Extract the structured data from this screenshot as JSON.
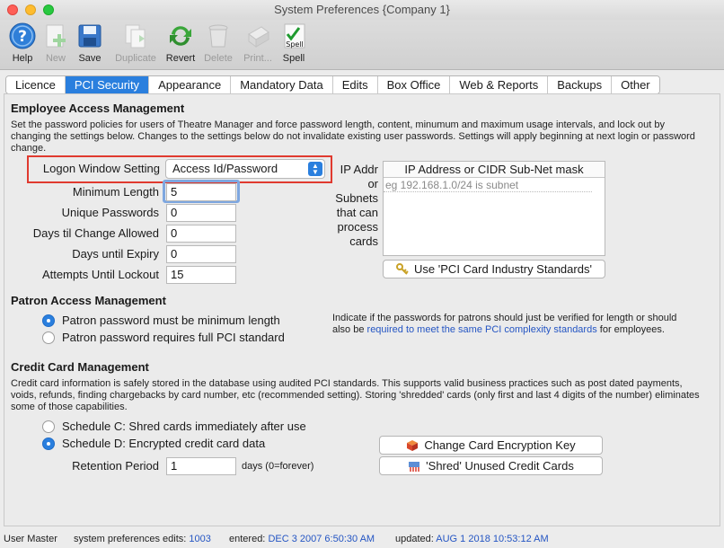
{
  "window": {
    "title": "System Preferences {Company 1}"
  },
  "toolbar": {
    "items": [
      {
        "label": "Help",
        "icon": "help-icon",
        "enabled": true
      },
      {
        "label": "New",
        "icon": "new-icon",
        "enabled": false
      },
      {
        "label": "Save",
        "icon": "save-icon",
        "enabled": true
      },
      {
        "label": "Duplicate",
        "icon": "duplicate-icon",
        "enabled": false
      },
      {
        "label": "Revert",
        "icon": "revert-icon",
        "enabled": true
      },
      {
        "label": "Delete",
        "icon": "delete-icon",
        "enabled": false
      },
      {
        "label": "Print...",
        "icon": "print-icon",
        "enabled": false
      },
      {
        "label": "Spell",
        "icon": "spell-icon",
        "enabled": true,
        "badge": "Spell"
      }
    ]
  },
  "tabs": [
    "Licence",
    "PCI Security",
    "Appearance",
    "Mandatory Data",
    "Edits",
    "Box Office",
    "Web & Reports",
    "Backups",
    "Other"
  ],
  "active_tab": "PCI Security",
  "employee": {
    "title": "Employee Access Management",
    "description": "Set the password policies for users of  Theatre Manager and force password length, content, minumum and maximum usage intervals, and lock out by changing the settings below.  Changes to the settings below do not invalidate existing user passwords.  Settings will apply beginning at next login or password change.",
    "logon_label": "Logon Window Setting",
    "logon_value": "Access Id/Password",
    "fields": [
      {
        "label": "Minimum Length",
        "value": "5"
      },
      {
        "label": "Unique Passwords",
        "value": "0"
      },
      {
        "label": "Days til Change Allowed",
        "value": "0"
      },
      {
        "label": "Days until Expiry",
        "value": "0"
      },
      {
        "label": "Attempts Until Lockout",
        "value": "15"
      }
    ],
    "ip_label": "IP Addr or Subnets that can process cards",
    "ip_label_lines": [
      "IP Addr",
      "or",
      "Subnets",
      "that can",
      "process",
      "cards"
    ],
    "ip_column_header": "IP Address or CIDR Sub-Net mask",
    "ip_placeholder": "eg 192.168.1.0/24 is subnet",
    "pci_button": "Use 'PCI Card Industry Standards'"
  },
  "patron": {
    "title": "Patron Access Management",
    "options": [
      {
        "label": "Patron password must be minimum length",
        "selected": true
      },
      {
        "label": "Patron password requires full PCI standard",
        "selected": false
      }
    ],
    "note_before": "Indicate if the passwords for patrons should just be verified for length or should also be ",
    "note_link": "required to meet the same PCI complexity standards",
    "note_after": " for employees."
  },
  "credit": {
    "title": "Credit Card Management",
    "description": "Credit card information is safely stored in the database using audited PCI standards.  This supports valid business practices such as post dated payments, voids, refunds, finding chargebacks by card number, etc (recommended setting).  Storing 'shredded' cards (only first and last 4 digits of the number) eliminates some of those capabilities.",
    "options": [
      {
        "label": "Schedule C: Shred cards immediately after use",
        "selected": false
      },
      {
        "label": "Schedule D: Encrypted credit card data",
        "selected": true
      }
    ],
    "retention_label": "Retention Period",
    "retention_value": "1",
    "retention_suffix": "days (0=forever)",
    "encryption_button": "Change Card Encryption Key",
    "shred_button": "'Shred' Unused Credit Cards"
  },
  "status": {
    "user": "User Master",
    "edits_label": "system preferences edits:",
    "edits_value": "1003",
    "entered_label": "entered:",
    "entered_value": "DEC 3 2007 6:50:30 AM",
    "updated_label": "updated:",
    "updated_value": "AUG 1 2018 10:53:12 AM"
  },
  "colors": {
    "accent": "#2a7fde",
    "highlight_box": "#e03a2f",
    "link": "#2455c3"
  }
}
